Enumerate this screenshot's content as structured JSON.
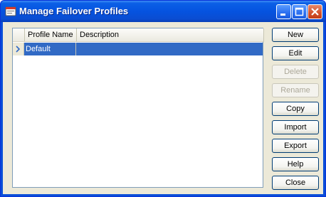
{
  "window": {
    "title": "Manage Failover Profiles"
  },
  "grid": {
    "columns": [
      "Profile Name",
      "Description"
    ],
    "rows": [
      {
        "name": "Default",
        "description": "",
        "selected": true
      }
    ]
  },
  "buttons": [
    {
      "label": "New",
      "enabled": true
    },
    {
      "label": "Edit",
      "enabled": true
    },
    {
      "label": "Delete",
      "enabled": false
    },
    {
      "label": "Rename",
      "enabled": false
    },
    {
      "label": "Copy",
      "enabled": true
    },
    {
      "label": "Import",
      "enabled": true
    },
    {
      "label": "Export",
      "enabled": true
    },
    {
      "label": "Help",
      "enabled": true
    },
    {
      "label": "Close",
      "enabled": true
    }
  ],
  "colors": {
    "selection": "#316ac5",
    "titlebar": "#0553e0",
    "client": "#ece9d8"
  },
  "icons": {
    "app": "app-window-icon",
    "row_indicator": "row-pointer-icon"
  }
}
